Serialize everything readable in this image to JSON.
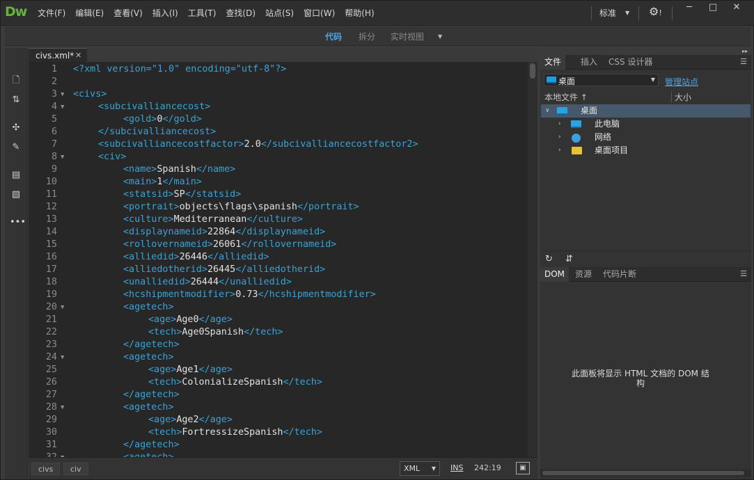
{
  "app": {
    "logo": "Dw"
  },
  "menus": [
    "文件(F)",
    "编辑(E)",
    "查看(V)",
    "插入(I)",
    "工具(T)",
    "查找(D)",
    "站点(S)",
    "窗口(W)",
    "帮助(H)"
  ],
  "workspace": "标准",
  "window_controls": {
    "minimize": "─",
    "maximize": "□",
    "close": "✕"
  },
  "view_tabs": [
    {
      "label": "代码",
      "active": true
    },
    {
      "label": "拆分",
      "active": false
    },
    {
      "label": "实时视图",
      "active": false
    }
  ],
  "document_tab": {
    "title": "civs.xml*"
  },
  "code_lines": [
    {
      "n": "1",
      "indent": 0,
      "fold": false,
      "parts": [
        [
          "tag",
          "<?xml version=\"1.0\" encoding=\"utf-8\"?>"
        ]
      ]
    },
    {
      "n": "2",
      "indent": 0,
      "fold": false,
      "parts": []
    },
    {
      "n": "3",
      "indent": 0,
      "fold": true,
      "parts": [
        [
          "tag",
          "<civs>"
        ]
      ]
    },
    {
      "n": "4",
      "indent": 1,
      "fold": true,
      "parts": [
        [
          "tag",
          "<subcivalliancecost>"
        ]
      ]
    },
    {
      "n": "5",
      "indent": 2,
      "fold": false,
      "parts": [
        [
          "tag",
          "<gold>"
        ],
        [
          "txt",
          "0"
        ],
        [
          "tag",
          "</gold>"
        ]
      ]
    },
    {
      "n": "6",
      "indent": 1,
      "fold": false,
      "parts": [
        [
          "tag",
          "</subcivalliancecost>"
        ]
      ]
    },
    {
      "n": "7",
      "indent": 1,
      "fold": false,
      "parts": [
        [
          "tag",
          "<subcivalliancecostfactor>"
        ],
        [
          "txt",
          "2.0"
        ],
        [
          "tag",
          "</subcivalliancecostfactor2>"
        ]
      ]
    },
    {
      "n": "8",
      "indent": 1,
      "fold": true,
      "parts": [
        [
          "tag",
          "<civ>"
        ]
      ]
    },
    {
      "n": "9",
      "indent": 2,
      "fold": false,
      "parts": [
        [
          "tag",
          "<name>"
        ],
        [
          "txt",
          "Spanish"
        ],
        [
          "tag",
          "</name>"
        ]
      ]
    },
    {
      "n": "10",
      "indent": 2,
      "fold": false,
      "parts": [
        [
          "tag",
          "<main>"
        ],
        [
          "txt",
          "1"
        ],
        [
          "tag",
          "</main>"
        ]
      ]
    },
    {
      "n": "11",
      "indent": 2,
      "fold": false,
      "parts": [
        [
          "tag",
          "<statsid>"
        ],
        [
          "txt",
          "SP"
        ],
        [
          "tag",
          "</statsid>"
        ]
      ]
    },
    {
      "n": "12",
      "indent": 2,
      "fold": false,
      "parts": [
        [
          "tag",
          "<portrait>"
        ],
        [
          "txt",
          "objects\\flags\\spanish"
        ],
        [
          "tag",
          "</portrait>"
        ]
      ]
    },
    {
      "n": "13",
      "indent": 2,
      "fold": false,
      "parts": [
        [
          "tag",
          "<culture>"
        ],
        [
          "txt",
          "Mediterranean"
        ],
        [
          "tag",
          "</culture>"
        ]
      ]
    },
    {
      "n": "14",
      "indent": 2,
      "fold": false,
      "parts": [
        [
          "tag",
          "<displaynameid>"
        ],
        [
          "txt",
          "22864"
        ],
        [
          "tag",
          "</displaynameid>"
        ]
      ]
    },
    {
      "n": "15",
      "indent": 2,
      "fold": false,
      "parts": [
        [
          "tag",
          "<rollovernameid>"
        ],
        [
          "txt",
          "26061"
        ],
        [
          "tag",
          "</rollovernameid>"
        ]
      ]
    },
    {
      "n": "16",
      "indent": 2,
      "fold": false,
      "parts": [
        [
          "tag",
          "<alliedid>"
        ],
        [
          "txt",
          "26446"
        ],
        [
          "tag",
          "</alliedid>"
        ]
      ]
    },
    {
      "n": "17",
      "indent": 2,
      "fold": false,
      "parts": [
        [
          "tag",
          "<alliedotherid>"
        ],
        [
          "txt",
          "26445"
        ],
        [
          "tag",
          "</alliedotherid>"
        ]
      ]
    },
    {
      "n": "18",
      "indent": 2,
      "fold": false,
      "parts": [
        [
          "tag",
          "<unalliedid>"
        ],
        [
          "txt",
          "26444"
        ],
        [
          "tag",
          "</unalliedid>"
        ]
      ]
    },
    {
      "n": "19",
      "indent": 2,
      "fold": false,
      "parts": [
        [
          "tag",
          "<hcshipmentmodifier>"
        ],
        [
          "txt",
          "0.73"
        ],
        [
          "tag",
          "</hcshipmentmodifier>"
        ]
      ]
    },
    {
      "n": "20",
      "indent": 2,
      "fold": true,
      "parts": [
        [
          "tag",
          "<agetech>"
        ]
      ]
    },
    {
      "n": "21",
      "indent": 3,
      "fold": false,
      "parts": [
        [
          "tag",
          "<age>"
        ],
        [
          "txt",
          "Age0"
        ],
        [
          "tag",
          "</age>"
        ]
      ]
    },
    {
      "n": "22",
      "indent": 3,
      "fold": false,
      "parts": [
        [
          "tag",
          "<tech>"
        ],
        [
          "txt",
          "Age0Spanish"
        ],
        [
          "tag",
          "</tech>"
        ]
      ]
    },
    {
      "n": "23",
      "indent": 2,
      "fold": false,
      "parts": [
        [
          "tag",
          "</agetech>"
        ]
      ]
    },
    {
      "n": "24",
      "indent": 2,
      "fold": true,
      "parts": [
        [
          "tag",
          "<agetech>"
        ]
      ]
    },
    {
      "n": "25",
      "indent": 3,
      "fold": false,
      "parts": [
        [
          "tag",
          "<age>"
        ],
        [
          "txt",
          "Age1"
        ],
        [
          "tag",
          "</age>"
        ]
      ]
    },
    {
      "n": "26",
      "indent": 3,
      "fold": false,
      "parts": [
        [
          "tag",
          "<tech>"
        ],
        [
          "txt",
          "ColonializeSpanish"
        ],
        [
          "tag",
          "</tech>"
        ]
      ]
    },
    {
      "n": "27",
      "indent": 2,
      "fold": false,
      "parts": [
        [
          "tag",
          "</agetech>"
        ]
      ]
    },
    {
      "n": "28",
      "indent": 2,
      "fold": true,
      "parts": [
        [
          "tag",
          "<agetech>"
        ]
      ]
    },
    {
      "n": "29",
      "indent": 3,
      "fold": false,
      "parts": [
        [
          "tag",
          "<age>"
        ],
        [
          "txt",
          "Age2"
        ],
        [
          "tag",
          "</age>"
        ]
      ]
    },
    {
      "n": "30",
      "indent": 3,
      "fold": false,
      "parts": [
        [
          "tag",
          "<tech>"
        ],
        [
          "txt",
          "FortressizeSpanish"
        ],
        [
          "tag",
          "</tech>"
        ]
      ]
    },
    {
      "n": "31",
      "indent": 2,
      "fold": false,
      "parts": [
        [
          "tag",
          "</agetech>"
        ]
      ]
    },
    {
      "n": "32",
      "indent": 2,
      "fold": true,
      "parts": [
        [
          "tag",
          "<agetech>"
        ]
      ]
    }
  ],
  "status_bar": {
    "breadcrumbs": [
      "civs",
      "civ"
    ],
    "language": "XML",
    "mode": "INS",
    "cursor": "242:19"
  },
  "files_panel": {
    "tabs": [
      "文件",
      "插入",
      "CSS 设计器"
    ],
    "site": "桌面",
    "manage_link": "管理站点",
    "col_local": "本地文件",
    "col_size": "大小",
    "tree": [
      {
        "label": "桌面",
        "level": 0,
        "expanded": true,
        "icon": "desktop-icon"
      },
      {
        "label": "此电脑",
        "level": 1,
        "expanded": false,
        "icon": "computer-icon"
      },
      {
        "label": "网络",
        "level": 1,
        "expanded": false,
        "icon": "network-icon"
      },
      {
        "label": "桌面项目",
        "level": 1,
        "expanded": false,
        "icon": "folder-icon"
      }
    ]
  },
  "dom_panel": {
    "tabs": [
      "DOM",
      "资源",
      "代码片断"
    ],
    "message": "此面板将显示 HTML 文档的 DOM 结构"
  }
}
